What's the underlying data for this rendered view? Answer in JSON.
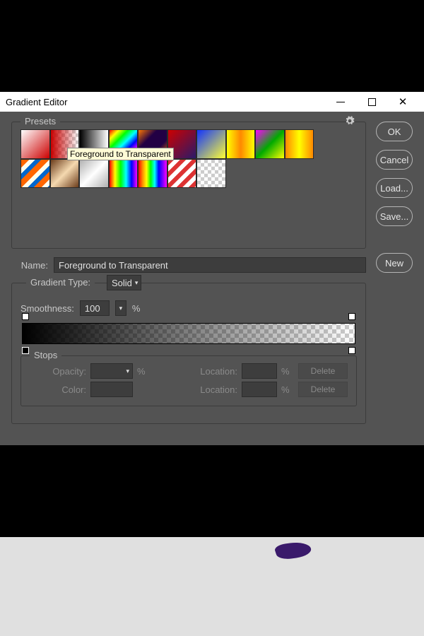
{
  "window": {
    "title": "Gradient Editor"
  },
  "buttons": {
    "ok": "OK",
    "cancel": "Cancel",
    "load": "Load...",
    "save": "Save...",
    "new": "New",
    "delete1": "Delete",
    "delete2": "Delete"
  },
  "presets": {
    "legend": "Presets",
    "tooltip": "Foreground to Transparent"
  },
  "name": {
    "label": "Name:",
    "value": "Foreground to Transparent"
  },
  "gradientType": {
    "label": "Gradient Type:",
    "value": "Solid"
  },
  "smoothness": {
    "label": "Smoothness:",
    "value": "100",
    "unit": "%"
  },
  "stops": {
    "legend": "Stops",
    "opacity_label": "Opacity:",
    "opacity_unit": "%",
    "color_label": "Color:",
    "location_label": "Location:",
    "location_unit": "%"
  }
}
